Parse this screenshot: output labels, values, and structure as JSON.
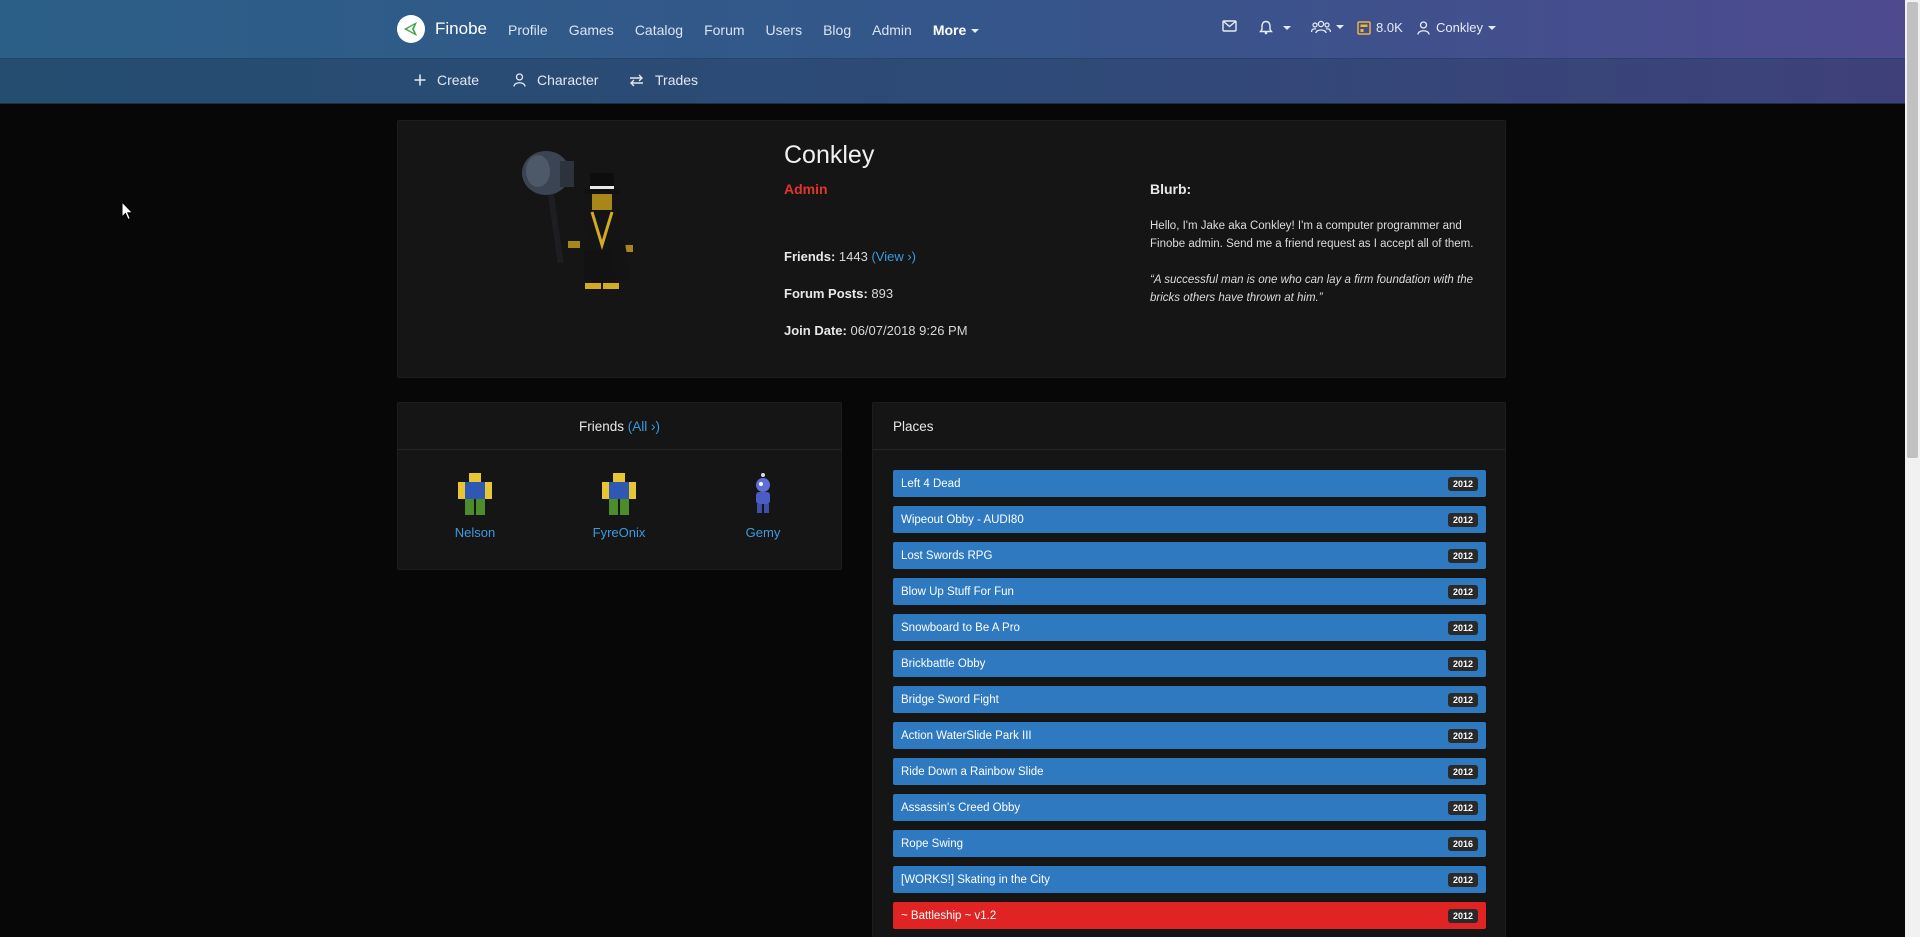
{
  "header": {
    "brand": "Finobe",
    "nav": [
      "Profile",
      "Games",
      "Catalog",
      "Forum",
      "Users",
      "Blog",
      "Admin"
    ],
    "more": "More",
    "currency": "8.0K",
    "user": "Conkley"
  },
  "subnav": [
    "Create",
    "Character",
    "Trades"
  ],
  "profile": {
    "username": "Conkley",
    "role": "Admin",
    "friends_label": "Friends:",
    "friends_count": "1443",
    "friends_view": "(View ›)",
    "posts_label": "Forum Posts:",
    "posts_count": "893",
    "join_label": "Join Date:",
    "join_date": "06/07/2018 9:26 PM",
    "blurb_title": "Blurb:",
    "blurb_text": "Hello, I'm Jake aka Conkley! I'm a computer programmer and Finobe admin. Send me a friend request as I accept all of them.",
    "blurb_quote": "“A successful man is one who can lay a firm foundation with the bricks others have thrown at him.”"
  },
  "friends": {
    "title": "Friends",
    "all_link": "(All ›)",
    "list": [
      "Nelson",
      "FyreOnix",
      "Gemy"
    ]
  },
  "places": {
    "title": "Places",
    "list": [
      {
        "name": "Left 4 Dead",
        "year": "2012"
      },
      {
        "name": "Wipeout Obby - AUDI80",
        "year": "2012"
      },
      {
        "name": "Lost Swords RPG",
        "year": "2012"
      },
      {
        "name": "Blow Up Stuff For Fun",
        "year": "2012"
      },
      {
        "name": "Snowboard to Be A Pro",
        "year": "2012"
      },
      {
        "name": "Brickbattle Obby",
        "year": "2012"
      },
      {
        "name": "Bridge Sword Fight",
        "year": "2012"
      },
      {
        "name": "Action WaterSlide Park III",
        "year": "2012"
      },
      {
        "name": "Ride Down a Rainbow Slide",
        "year": "2012"
      },
      {
        "name": "Assassin's Creed Obby",
        "year": "2012"
      },
      {
        "name": "Rope Swing",
        "year": "2016"
      },
      {
        "name": "[WORKS!] Skating in the City",
        "year": "2012"
      },
      {
        "name": "~ Battleship ~ v1.2",
        "year": "2012"
      }
    ]
  },
  "colors": {
    "accent": "#2e79bf",
    "danger": "#e02424",
    "link": "#3b9be0"
  }
}
